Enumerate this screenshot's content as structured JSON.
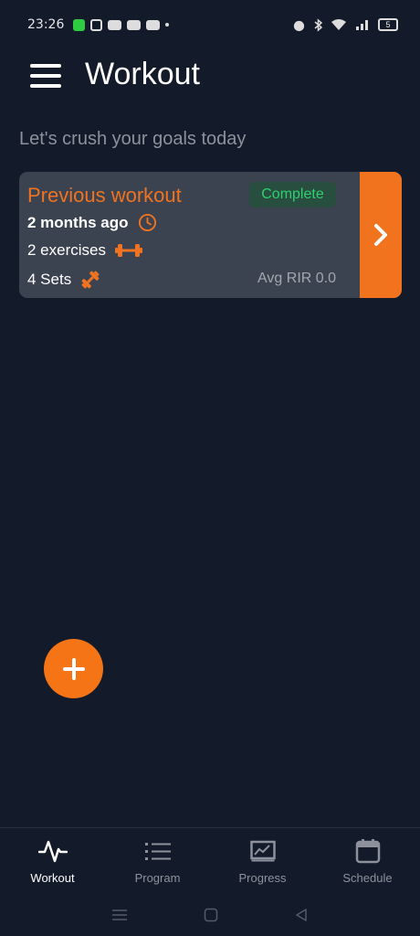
{
  "status_bar": {
    "time": "23:26",
    "battery": "5"
  },
  "app_bar": {
    "title": "Workout"
  },
  "subtitle": "Let's crush your goals today",
  "card": {
    "title": "Previous workout",
    "badge": "Complete",
    "time_ago": "2 months ago",
    "exercises": "2 exercises",
    "sets": "4 Sets",
    "avg_rir": "Avg RIR 0.0"
  },
  "colors": {
    "accent": "#f1731d",
    "background": "#131a2a",
    "card": "#3c4350",
    "complete": "#2fd070"
  },
  "nav": [
    {
      "label": "Workout",
      "icon": "pulse-icon",
      "active": true
    },
    {
      "label": "Program",
      "icon": "list-icon",
      "active": false
    },
    {
      "label": "Progress",
      "icon": "chart-icon",
      "active": false
    },
    {
      "label": "Schedule",
      "icon": "calendar-icon",
      "active": false
    }
  ]
}
